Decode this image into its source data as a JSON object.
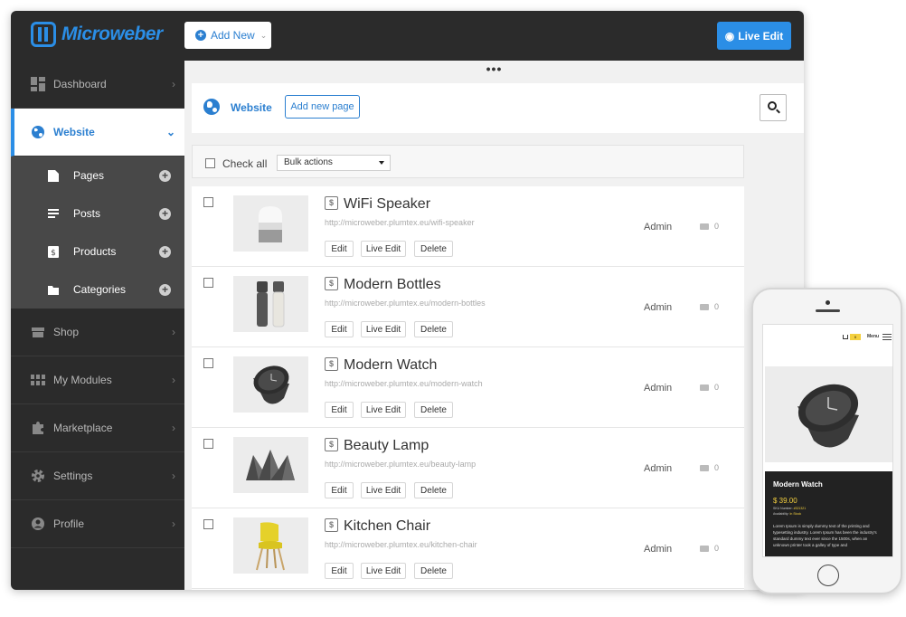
{
  "app": {
    "logo_text": "Microweber",
    "accent": "#2b8ee6"
  },
  "topbar": {
    "add_new_label": "Add New",
    "live_edit_label": "Live Edit"
  },
  "sidebar": {
    "items": [
      {
        "label": "Dashboard",
        "icon": "dashboard-icon"
      },
      {
        "label": "Website",
        "icon": "globe-icon",
        "active": true
      },
      {
        "label": "Shop",
        "icon": "shop-icon"
      },
      {
        "label": "My Modules",
        "icon": "modules-icon"
      },
      {
        "label": "Marketplace",
        "icon": "puzzle-icon"
      },
      {
        "label": "Settings",
        "icon": "gear-icon"
      },
      {
        "label": "Profile",
        "icon": "user-icon"
      }
    ],
    "subitems": [
      {
        "label": "Pages",
        "icon": "page-icon"
      },
      {
        "label": "Posts",
        "icon": "posts-icon"
      },
      {
        "label": "Products",
        "icon": "product-icon"
      },
      {
        "label": "Categories",
        "icon": "folder-icon"
      }
    ]
  },
  "main": {
    "dots": "•••",
    "crumb_title": "Website",
    "add_page_label": "Add new page",
    "check_all_label": "Check all",
    "bulk_actions_label": "Bulk actions",
    "rows": [
      {
        "title": "WiFi Speaker",
        "url": "http://microweber.plumtex.eu/wifi-speaker",
        "author": "Admin",
        "comments": "0",
        "image": "speaker"
      },
      {
        "title": "Modern Bottles",
        "url": "http://microweber.plumtex.eu/modern-bottles",
        "author": "Admin",
        "comments": "0",
        "image": "bottles"
      },
      {
        "title": "Modern Watch",
        "url": "http://microweber.plumtex.eu/modern-watch",
        "author": "Admin",
        "comments": "0",
        "image": "watch"
      },
      {
        "title": "Beauty Lamp",
        "url": "http://microweber.plumtex.eu/beauty-lamp",
        "author": "Admin",
        "comments": "0",
        "image": "lamp"
      },
      {
        "title": "Kitchen Chair",
        "url": "http://microweber.plumtex.eu/kitchen-chair",
        "author": "Admin",
        "comments": "0",
        "image": "chair"
      }
    ],
    "row_actions": {
      "edit": "Edit",
      "live_edit": "Live Edit",
      "delete": "Delete"
    }
  },
  "phone": {
    "cart_count": "0",
    "menu_label": "Menu",
    "product_title": "Modern Watch",
    "price": "$ 39.00",
    "sku_label": "SKU Number:",
    "sku_value": "#321321",
    "availability_label": "Availability:",
    "availability_value": "In Stock",
    "description": "Lorem Ipsum is simply dummy text of the printing and typesetting industry. Lorem Ipsum has been the industry's standard dummy text ever since the 1500s, when an unknown printer took a galley of type and"
  }
}
